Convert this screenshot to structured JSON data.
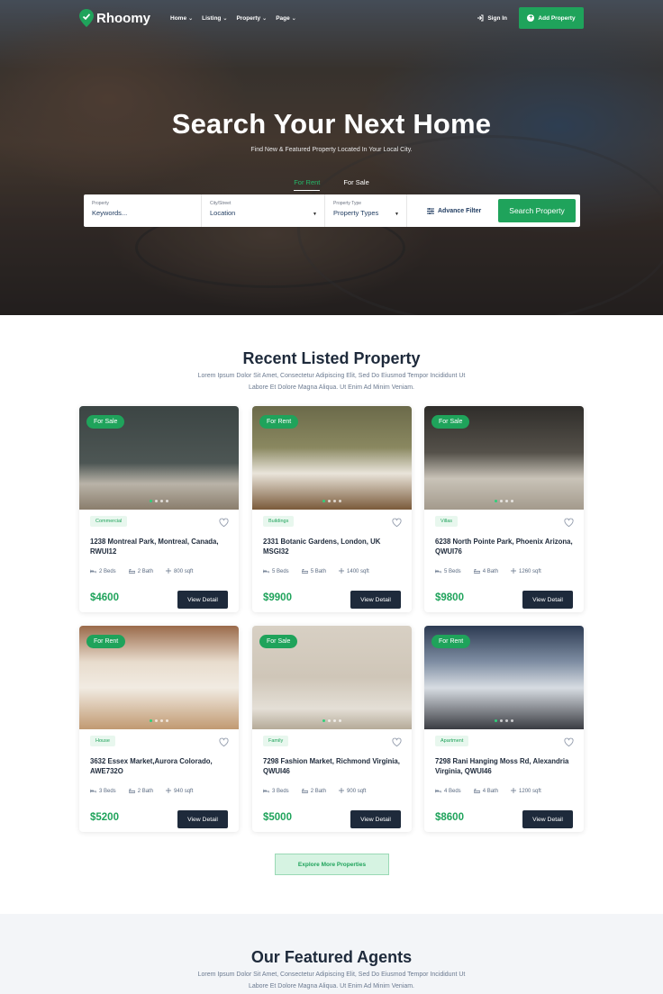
{
  "brand": {
    "name": "Rhoomy",
    "accent": "#1fa35b",
    "dark": "#1e2a3b"
  },
  "nav": {
    "items": [
      {
        "label": "Home",
        "icon": "chevron-down-icon"
      },
      {
        "label": "Listing",
        "icon": "chevron-down-icon"
      },
      {
        "label": "Property",
        "icon": "chevron-down-icon"
      },
      {
        "label": "Page",
        "icon": "chevron-down-icon"
      }
    ],
    "signin": "Sign In",
    "add_property": "Add Property"
  },
  "hero": {
    "title": "Search Your Next Home",
    "subtitle": "Find New & Featured Property Located In Your Local City.",
    "tabs": [
      "For Rent",
      "For Sale"
    ],
    "active_tab": "For Rent",
    "search": {
      "property_label": "Property",
      "property_placeholder": "Keywords...",
      "city_label": "City/Street",
      "city_value": "Location",
      "type_label": "Property Type",
      "type_value": "Property Types",
      "advance_filter": "Advance Filter",
      "button": "Search Property"
    }
  },
  "recent": {
    "title": "Recent Listed Property",
    "description_line1": "Lorem Ipsum Dolor Sit Amet, Consectetur Adipiscing Elit, Sed Do Eiusmod Tempor Incididunt Ut",
    "description_line2": "Labore Et Dolore Magna Aliqua. Ut Enim Ad Minim Veniam.",
    "detail_label": "View Detail",
    "properties": [
      {
        "status": "For Sale",
        "category": "Commercial",
        "address": "1238 Montreal Park, Montreal, Canada, RWUI12",
        "beds": "2 Beds",
        "bath": "2 Bath",
        "area": "800 sqft",
        "price": "$4600"
      },
      {
        "status": "For Rent",
        "category": "Buildings",
        "address": "2331 Botanic Gardens, London, UK MSGI32",
        "beds": "5 Beds",
        "bath": "5 Bath",
        "area": "1400 sqft",
        "price": "$9900"
      },
      {
        "status": "For Sale",
        "category": "Villas",
        "address": "6238 North Pointe Park, Phoenix Arizona, QWUI76",
        "beds": "5 Beds",
        "bath": "4 Bath",
        "area": "1260 sqft",
        "price": "$9800"
      },
      {
        "status": "For Rent",
        "category": "House",
        "address": "3632 Essex Market,Aurora Colorado, AWE732O",
        "beds": "3 Beds",
        "bath": "2 Bath",
        "area": "940 sqft",
        "price": "$5200"
      },
      {
        "status": "For Sale",
        "category": "Family",
        "address": "7298 Fashion Market, Richmond Virginia, QWUI46",
        "beds": "3 Beds",
        "bath": "2 Bath",
        "area": "900 sqft",
        "price": "$5000"
      },
      {
        "status": "For Rent",
        "category": "Apartment",
        "address": "7298 Rani Hanging Moss Rd, Alexandria Virginia, QWUI46",
        "beds": "4 Beds",
        "bath": "4 Bath",
        "area": "1200 sqft",
        "price": "$8600"
      }
    ],
    "explore": "Explore More Properties"
  },
  "agents": {
    "title": "Our Featured Agents",
    "description_line1": "Lorem Ipsum Dolor Sit Amet, Consectetur Adipiscing Elit, Sed Do Eiusmod Tempor Incididunt Ut",
    "description_line2": "Labore Et Dolore Magna Aliqua. Ut Enim Ad Minim Veniam."
  }
}
